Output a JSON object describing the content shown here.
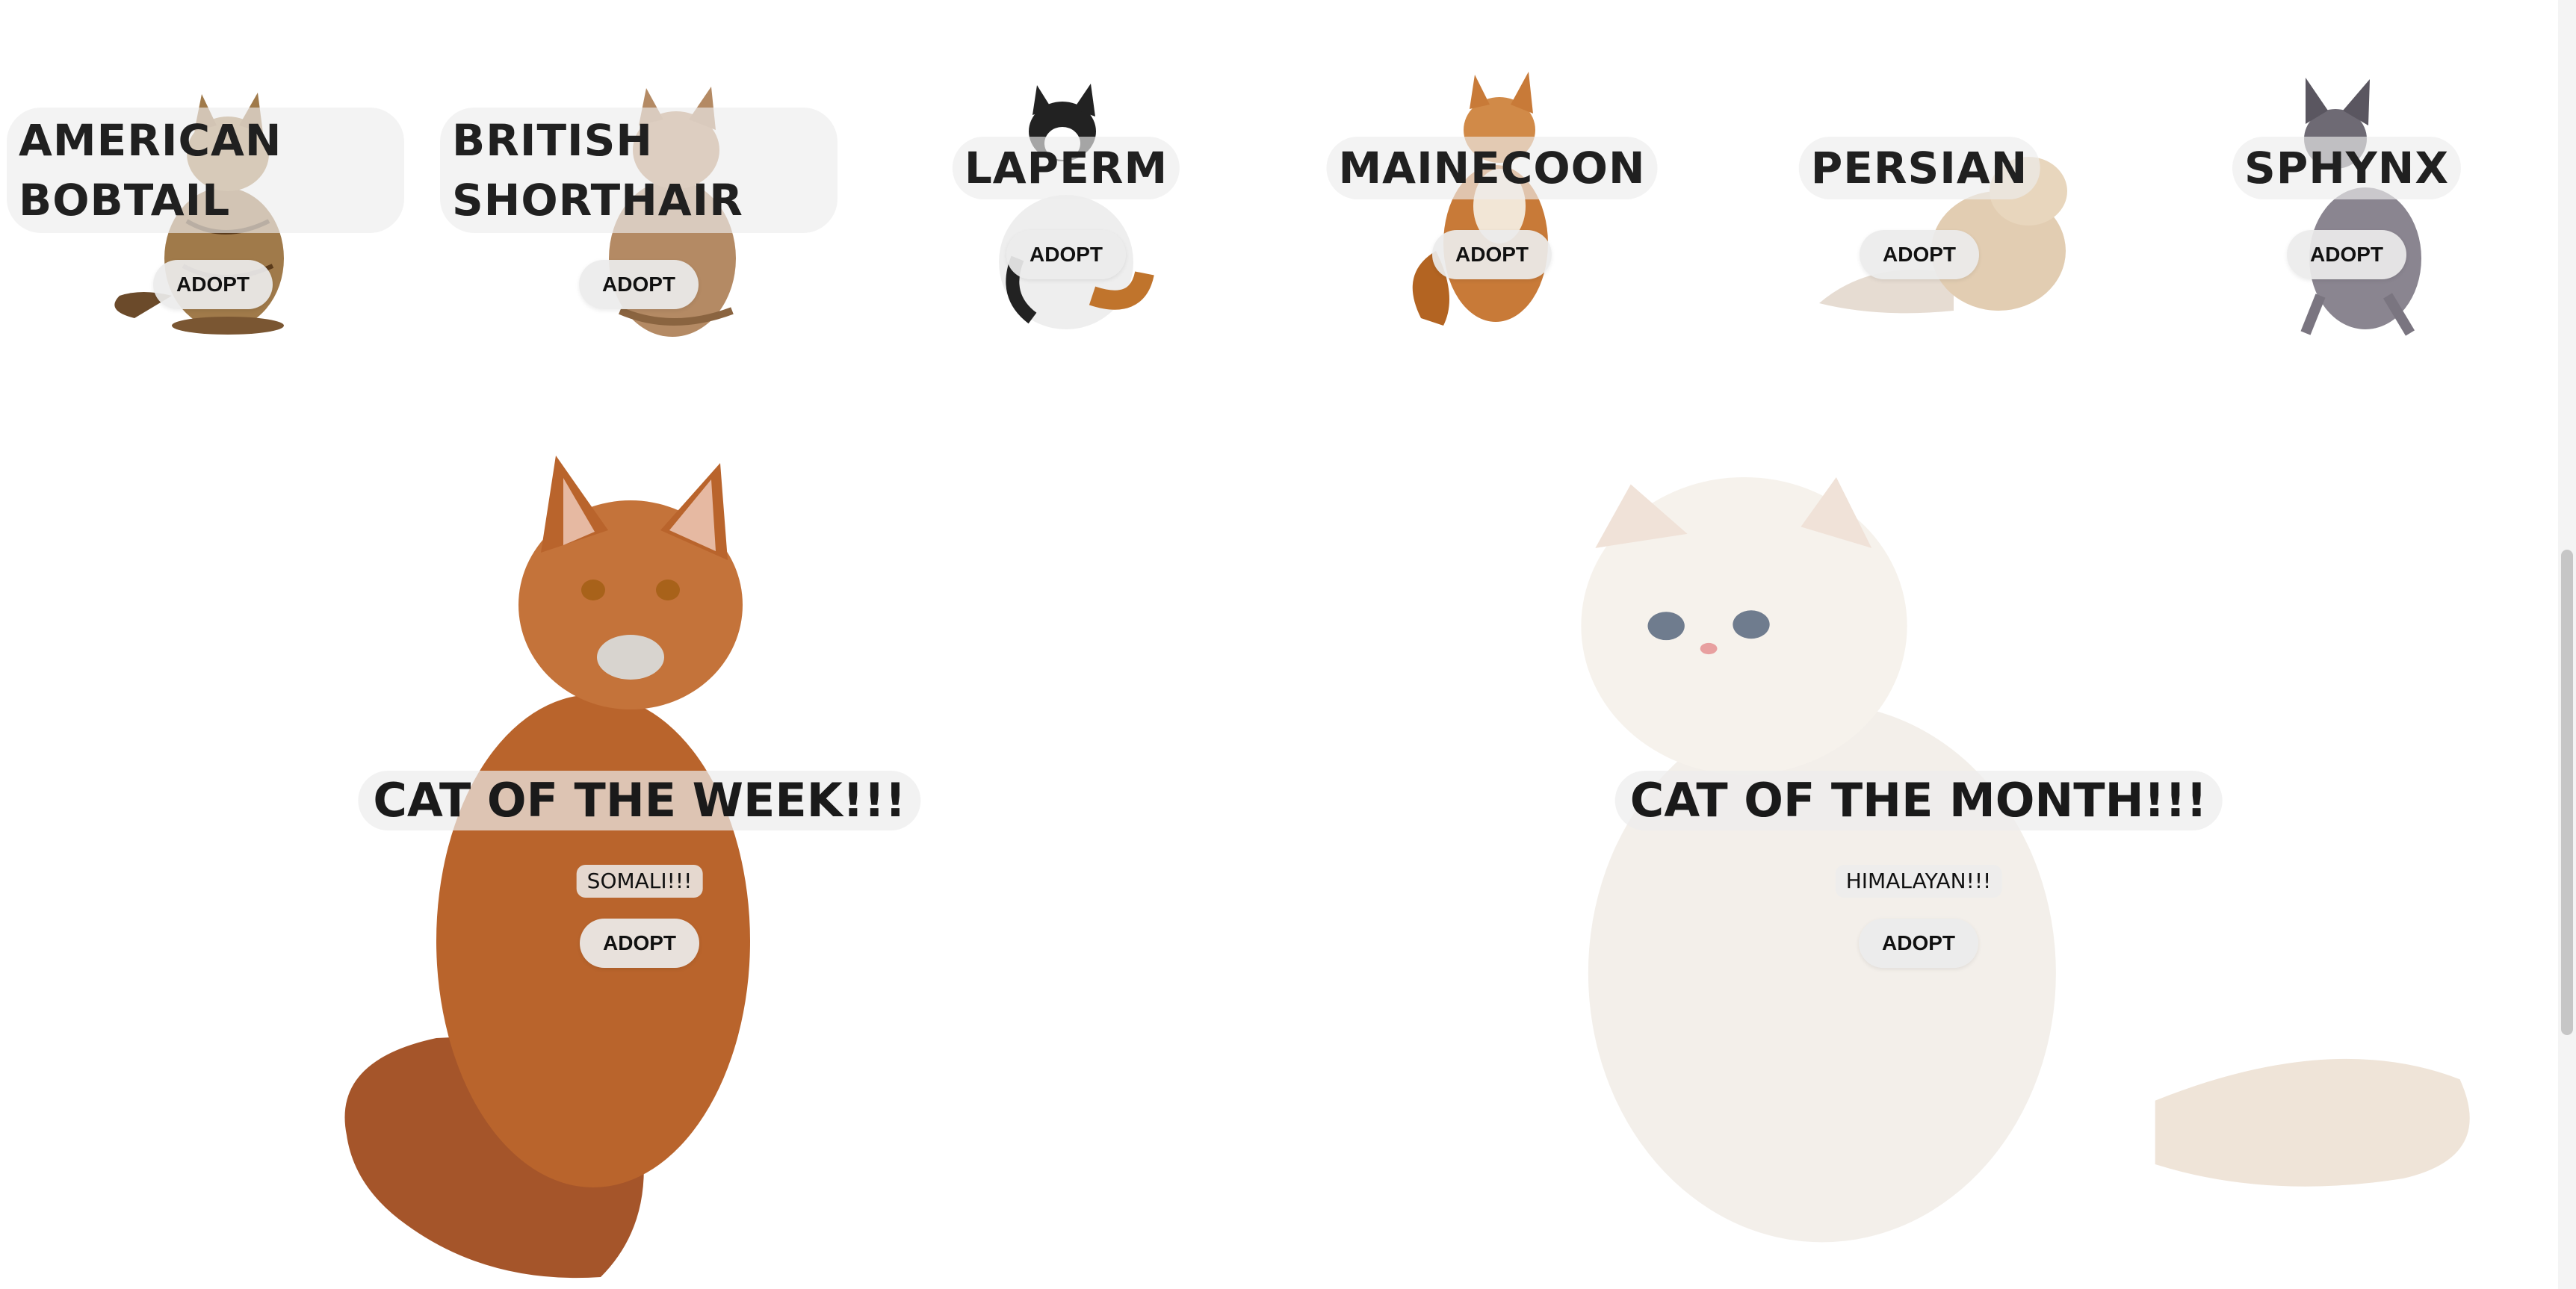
{
  "breeds": [
    {
      "name": "AMERICAN BOBTAIL",
      "adopt_label": "ADOPT",
      "coat": "#a07a4a",
      "icon": "cat-photo"
    },
    {
      "name": "BRITISH SHORTHAIR",
      "adopt_label": "ADOPT",
      "coat": "#b48a64",
      "icon": "cat-photo"
    },
    {
      "name": "LAPERM",
      "adopt_label": "ADOPT",
      "coat": "#e8e8e8",
      "icon": "cat-photo"
    },
    {
      "name": "MAINECOON",
      "adopt_label": "ADOPT",
      "coat": "#c87a38",
      "icon": "cat-photo"
    },
    {
      "name": "PERSIAN",
      "adopt_label": "ADOPT",
      "coat": "#e2cdb2",
      "icon": "cat-photo"
    },
    {
      "name": "SPHYNX",
      "adopt_label": "ADOPT",
      "coat": "#8a8590",
      "icon": "cat-photo"
    }
  ],
  "featured": {
    "week": {
      "title": "CAT OF THE WEEK!!!",
      "breed": "SOMALI!!!",
      "adopt_label": "ADOPT",
      "coat": "#b9642c"
    },
    "month": {
      "title": "CAT OF THE MONTH!!!",
      "breed": "HIMALAYAN!!!",
      "adopt_label": "ADOPT",
      "coat": "#f3efea"
    }
  }
}
